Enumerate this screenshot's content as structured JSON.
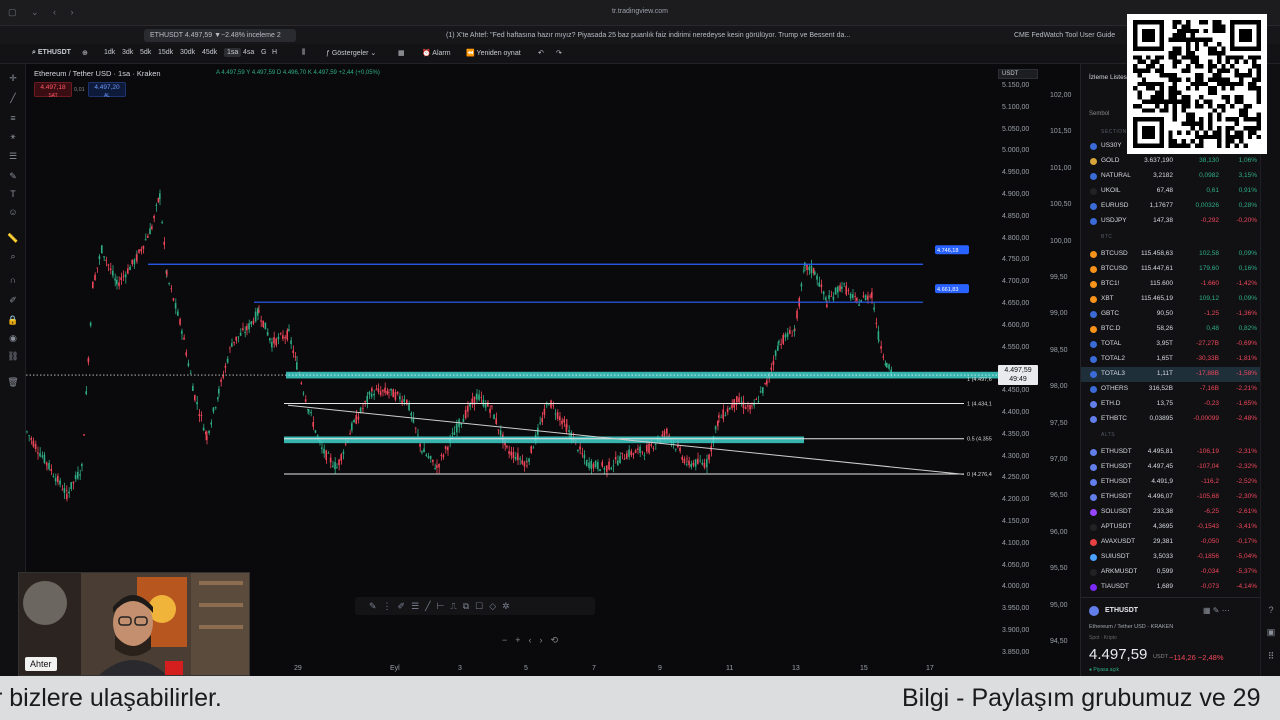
{
  "browser": {
    "url": "tr.tradingview.com"
  },
  "tabs": [
    {
      "label": "ETHUSDT 4.497,59 ▼−2.48% inceleme 2",
      "active": true
    },
    {
      "label": "(1) X'te Ahtef: \"Fed haftasına hazır mıyız? Piyasada 25 baz puanlık faiz indirimi neredeyse kesin görülüyor. Trump ve Bessent da...",
      "active": false
    },
    {
      "label": "CME FedWatch Tool User Guide",
      "active": false
    }
  ],
  "toolbar": {
    "symbol": "ETHUSDT",
    "intervals": [
      "1dk",
      "3dk",
      "5dk",
      "15dk",
      "30dk",
      "45dk",
      "1sa",
      "4sa",
      "G",
      "H"
    ],
    "selected_interval": "1sa",
    "indicators": "Göstergeler",
    "alarm": "Alarm",
    "replay": "Yeniden oynat"
  },
  "chart": {
    "title": "Ethereum / Tether USD · 1sa · Kraken",
    "ohlc": "A 4.497,59  Y 4.497,59  D 4.496,70  K 4.497,59  +2,44 (+0,05%)",
    "sell_price": "4.497,18",
    "sell_label": "SAT",
    "buy_price": "4.497,20",
    "buy_label": "AL",
    "spread": "0,01",
    "currency": "USDT",
    "current_price": "4.497,59",
    "countdown": "49:49",
    "blue_line_1_label": "4.746,18",
    "blue_line_2_label": "4.661,83",
    "fib_1_label": "1 (4.434,1",
    "fib_05_label": "0.5 (4.355",
    "fib_0_label": "0 (4.276,4",
    "dotted_label": "1 (4.497,6"
  },
  "price_axis": [
    "5.150,00",
    "5.100,00",
    "5.050,00",
    "5.000,00",
    "4.950,00",
    "4.900,00",
    "4.850,00",
    "4.800,00",
    "4.750,00",
    "4.700,00",
    "4.650,00",
    "4.600,00",
    "4.550,00",
    "4.500,00",
    "4.450,00",
    "4.400,00",
    "4.350,00",
    "4.300,00",
    "4.250,00",
    "4.200,00",
    "4.150,00",
    "4.100,00",
    "4.050,00",
    "4.000,00",
    "3.950,00",
    "3.900,00",
    "3.850,00"
  ],
  "pct_axis": [
    "102,00",
    "101,50",
    "101,00",
    "100,50",
    "100,00",
    "99,50",
    "99,00",
    "98,50",
    "98,00",
    "97,50",
    "97,00",
    "96,50",
    "96,00",
    "95,50",
    "95,00",
    "94,50"
  ],
  "date_axis": [
    "29",
    "Eyl",
    "3",
    "5",
    "7",
    "9",
    "11",
    "13",
    "15",
    "17"
  ],
  "watchlist": {
    "header": "İzleme Listesi",
    "subheader": "Sembol",
    "sections": [
      "SECTION",
      "BTC",
      "ALTS"
    ],
    "rows": [
      {
        "sym": "US30Y",
        "last": "",
        "chg": "",
        "chgp": "",
        "color": "#3a6bd6",
        "dir": "pos"
      },
      {
        "sym": "GOLD",
        "last": "3.637,190",
        "chg": "38,130",
        "chgp": "1,06%",
        "color": "#d8a53a",
        "dir": "pos"
      },
      {
        "sym": "NATURAL",
        "last": "3,2182",
        "chg": "0,0982",
        "chgp": "3,15%",
        "color": "#3a6bd6",
        "dir": "pos"
      },
      {
        "sym": "UKOIL",
        "last": "67,48",
        "chg": "0,61",
        "chgp": "0,91%",
        "color": "#222222",
        "dir": "pos"
      },
      {
        "sym": "EURUSD",
        "last": "1,17677",
        "chg": "0,00326",
        "chgp": "0,28%",
        "color": "#3a6bd6",
        "dir": "pos"
      },
      {
        "sym": "USDJPY",
        "last": "147,38",
        "chg": "-0,292",
        "chgp": "-0,20%",
        "color": "#3a6bd6",
        "dir": "neg"
      },
      {
        "sym": "BTCUSD",
        "last": "115.458,63",
        "chg": "102,58",
        "chgp": "0,09%",
        "color": "#f7931a",
        "dir": "pos"
      },
      {
        "sym": "BTCUSD",
        "last": "115.447,61",
        "chg": "179,60",
        "chgp": "0,16%",
        "color": "#f7931a",
        "dir": "pos"
      },
      {
        "sym": "BTC1!",
        "last": "115.600",
        "chg": "-1.660",
        "chgp": "-1,42%",
        "color": "#f7931a",
        "dir": "neg"
      },
      {
        "sym": "XBT",
        "last": "115.465,19",
        "chg": "109,12",
        "chgp": "0,09%",
        "color": "#f7931a",
        "dir": "pos"
      },
      {
        "sym": "GBTC",
        "last": "90,50",
        "chg": "-1,25",
        "chgp": "-1,36%",
        "color": "#3a6bd6",
        "dir": "neg"
      },
      {
        "sym": "BTC.D",
        "last": "58,26",
        "chg": "0,48",
        "chgp": "0,82%",
        "color": "#f7931a",
        "dir": "pos"
      },
      {
        "sym": "TOTAL",
        "last": "3,95T",
        "chg": "-27,27B",
        "chgp": "-0,69%",
        "color": "#3a6bd6",
        "dir": "neg"
      },
      {
        "sym": "TOTAL2",
        "last": "1,65T",
        "chg": "-30,33B",
        "chgp": "-1,81%",
        "color": "#3a6bd6",
        "dir": "neg"
      },
      {
        "sym": "TOTAL3",
        "last": "1,11T",
        "chg": "-17,88B",
        "chgp": "-1,58%",
        "color": "#3a6bd6",
        "dir": "neg",
        "hl": true
      },
      {
        "sym": "OTHERS",
        "last": "316,52B",
        "chg": "-7,16B",
        "chgp": "-2,21%",
        "color": "#3a6bd6",
        "dir": "neg"
      },
      {
        "sym": "ETH.D",
        "last": "13,75",
        "chg": "-0,23",
        "chgp": "-1,65%",
        "color": "#627eea",
        "dir": "neg"
      },
      {
        "sym": "ETHBTC",
        "last": "0,03895",
        "chg": "-0,00099",
        "chgp": "-2,48%",
        "color": "#627eea",
        "dir": "neg"
      },
      {
        "sym": "ETHUSDT",
        "last": "4.495,81",
        "chg": "-106,19",
        "chgp": "-2,31%",
        "color": "#627eea",
        "dir": "neg"
      },
      {
        "sym": "ETHUSDT",
        "last": "4.497,45",
        "chg": "-107,04",
        "chgp": "-2,32%",
        "color": "#627eea",
        "dir": "neg"
      },
      {
        "sym": "ETHUSDT",
        "last": "4.491,9",
        "chg": "-116,2",
        "chgp": "-2,52%",
        "color": "#627eea",
        "dir": "neg"
      },
      {
        "sym": "ETHUSDT",
        "last": "4.496,07",
        "chg": "-105,68",
        "chgp": "-2,30%",
        "color": "#627eea",
        "dir": "neg"
      },
      {
        "sym": "SOLUSDT",
        "last": "233,38",
        "chg": "-6,25",
        "chgp": "-2,61%",
        "color": "#9945ff",
        "dir": "neg"
      },
      {
        "sym": "APTUSDT",
        "last": "4,3695",
        "chg": "-0,1543",
        "chgp": "-3,41%",
        "color": "#222222",
        "dir": "neg"
      },
      {
        "sym": "AVAXUSDT",
        "last": "29,381",
        "chg": "-0,050",
        "chgp": "-0,17%",
        "color": "#e84142",
        "dir": "neg"
      },
      {
        "sym": "SUIUSDT",
        "last": "3,5033",
        "chg": "-0,1856",
        "chgp": "-5,04%",
        "color": "#4ca3ff",
        "dir": "neg"
      },
      {
        "sym": "ARKMUSDT",
        "last": "0,599",
        "chg": "-0,034",
        "chgp": "-5,37%",
        "color": "#222222",
        "dir": "neg"
      },
      {
        "sym": "TIAUSDT",
        "last": "1,689",
        "chg": "-0,073",
        "chgp": "-4,14%",
        "color": "#7b2bf9",
        "dir": "neg"
      }
    ]
  },
  "detail": {
    "symbol": "ETHUSDT",
    "name": "Ethereum / Tether USD · KRAKEN",
    "type": "Spot · Kripto",
    "price": "4.497,59",
    "currency": "USDT",
    "change": "−114,26  −2,48%",
    "status": "● Piyasa açık"
  },
  "webcam": {
    "name": "Ahter"
  },
  "ticker": {
    "left": "r bizlere ulaşabilirler.",
    "right": "Bilgi - Paylaşım grubumuz ve 29"
  },
  "colors": {
    "up": "#2fae85",
    "down": "#f0475a",
    "zone": "#3fd1cb",
    "blue_line": "#2962ff"
  }
}
